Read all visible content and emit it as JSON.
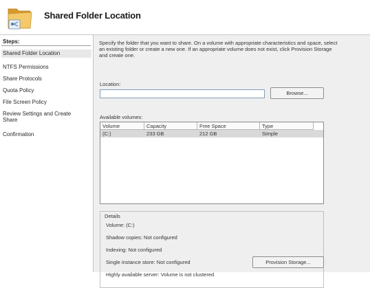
{
  "header": {
    "title": "Shared Folder Location"
  },
  "sidebar": {
    "steps_label": "Steps:",
    "items": [
      {
        "label": "Shared Folder Location"
      },
      {
        "label": "NTFS Permissions"
      },
      {
        "label": "Share Protocols"
      },
      {
        "label": "Quota Policy"
      },
      {
        "label": "File Screen Policy"
      },
      {
        "label": "Review Settings and Create Share"
      },
      {
        "label": "Confirmation"
      }
    ]
  },
  "main": {
    "description": "Specify the folder that you want to share. On a volume with appropriate characteristics and space, select an existing folder or create a new one. If an appropriate volume does not exist, click Provision Storage and create one.",
    "location_label": "Location:",
    "location_value": "",
    "browse_label": "Browse...",
    "available_volumes_label": "Available volumes:",
    "columns": [
      "Volume",
      "Capacity",
      "Free Space",
      "Type"
    ],
    "rows": [
      {
        "volume": "(C:)",
        "capacity": "233 GB",
        "free_space": "212 GB",
        "type": "Simple"
      }
    ],
    "details": {
      "legend": "Details",
      "volume": "Volume:   (C:)",
      "shadow_copies": "Shadow copies:   Not configured",
      "indexing": "Indexing:   Not configured",
      "single_instance": "Single instance store:   Not configured",
      "highly_available": "Highly available server:   Volume is not clustered"
    },
    "provision_label": "Provision Storage..."
  },
  "colors": {
    "selected_row": "#d9d9d9",
    "panel_bg": "#efefef",
    "folder": "#e8b84a"
  }
}
